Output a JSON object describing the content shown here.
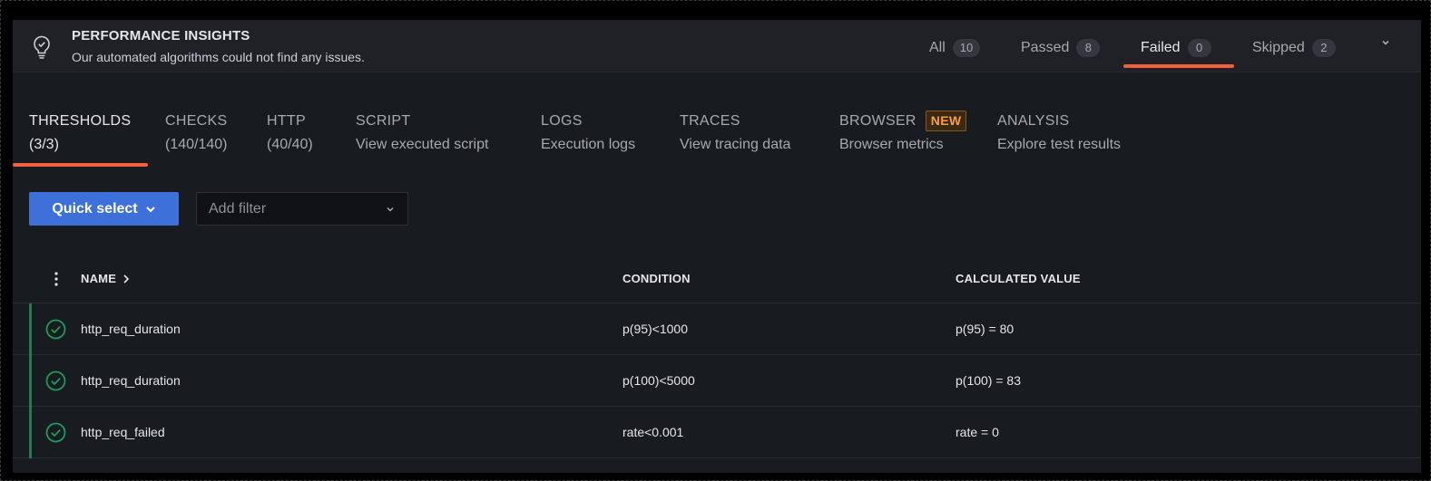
{
  "insights": {
    "title": "PERFORMANCE INSIGHTS",
    "subtitle": "Our automated algorithms could not find any issues.",
    "icon": "lightbulb-check-icon",
    "filters": [
      {
        "label": "All",
        "count": "10",
        "active": false
      },
      {
        "label": "Passed",
        "count": "8",
        "active": false
      },
      {
        "label": "Failed",
        "count": "0",
        "active": true
      },
      {
        "label": "Skipped",
        "count": "2",
        "active": false
      }
    ],
    "accent": "#f55f3e"
  },
  "tabs": [
    {
      "title": "THRESHOLDS",
      "sub": "(3/3)",
      "active": true
    },
    {
      "title": "CHECKS",
      "sub": "(140/140)"
    },
    {
      "title": "HTTP",
      "sub": "(40/40)"
    },
    {
      "title": "SCRIPT",
      "sub": "View executed script"
    },
    {
      "title": "LOGS",
      "sub": "Execution logs"
    },
    {
      "title": "TRACES",
      "sub": "View tracing data"
    },
    {
      "title": "BROWSER",
      "sub": "Browser metrics",
      "badge": "NEW"
    },
    {
      "title": "ANALYSIS",
      "sub": "Explore test results"
    }
  ],
  "controls": {
    "quick_select": "Quick select",
    "filter_placeholder": "Add filter",
    "primary_color": "#3d71d9"
  },
  "table": {
    "headers": {
      "name": "NAME",
      "condition": "CONDITION",
      "value": "CALCULATED VALUE"
    },
    "status_color": "#1a7f4b",
    "rows": [
      {
        "name": "http_req_duration",
        "condition": "p(95)<1000",
        "value": "p(95) = 80",
        "status": "passed"
      },
      {
        "name": "http_req_duration",
        "condition": "p(100)<5000",
        "value": "p(100) = 83",
        "status": "passed"
      },
      {
        "name": "http_req_failed",
        "condition": "rate<0.001",
        "value": "rate = 0",
        "status": "passed"
      }
    ]
  }
}
